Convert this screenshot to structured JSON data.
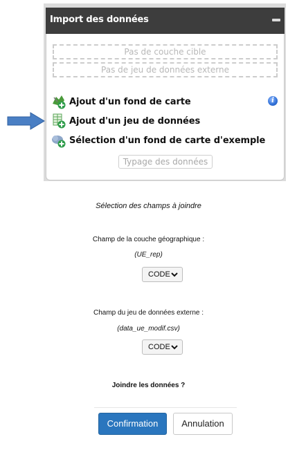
{
  "panel": {
    "title": "Import des données",
    "target_layer_placeholder": "Pas de couche cible",
    "external_dataset_placeholder": "Pas de jeu de données externe",
    "menu": [
      {
        "label": "Ajout d'un fond de carte",
        "icon": "add-basemap-icon"
      },
      {
        "label": "Ajout d'un jeu de données",
        "icon": "add-dataset-icon"
      },
      {
        "label": "Sélection d'un fond de carte d'exemple",
        "icon": "example-basemap-icon"
      }
    ],
    "typing_button": "Typage des données",
    "info_glyph": "i"
  },
  "dialog": {
    "title": "Sélection des champs à joindre",
    "geo_field_label": "Champ de la couche géographique :",
    "geo_layer_name": "(UE_rep)",
    "geo_field_value": "CODE",
    "ext_field_label": "Champ du jeu de données externe :",
    "ext_file_name": "(data_ue_modif.csv)",
    "ext_field_value": "CODE",
    "join_question": "Joindre les données ?",
    "confirm_label": "Confirmation",
    "cancel_label": "Annulation"
  },
  "colors": {
    "header_bg": "#3d3d3d",
    "confirm_bg": "#2a76be",
    "arrow": "#4a7fc4"
  }
}
